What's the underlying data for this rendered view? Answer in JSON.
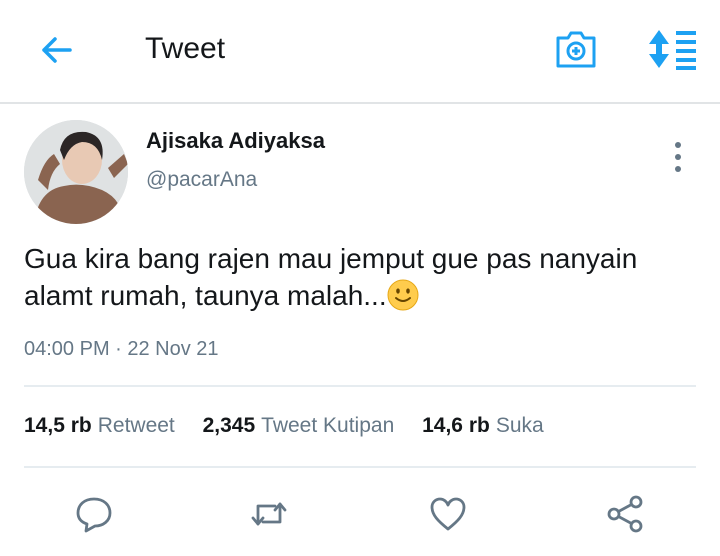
{
  "header": {
    "title": "Tweet",
    "back_icon": "arrow-left-icon",
    "camera_icon": "camera-plus-icon",
    "sort_icon": "sort-list-icon",
    "accent_color": "#1da1f2"
  },
  "tweet": {
    "author_name": "Ajisaka Adiyaksa",
    "author_handle": "@pacarAna",
    "text": "Gua kira bang rajen mau jemput gue pas nanyain alamt rumah, taunya malah...",
    "emoji": "slightly-smiling-face",
    "timestamp": "04:00 PM · 22 Nov 21"
  },
  "stats": {
    "retweets_count": "14,5 rb",
    "retweets_label": "Retweet",
    "quotes_count": "2,345",
    "quotes_label": "Tweet Kutipan",
    "likes_count": "14,6 rb",
    "likes_label": "Suka"
  },
  "actions": [
    "reply-icon",
    "retweet-icon",
    "like-icon",
    "share-icon"
  ]
}
